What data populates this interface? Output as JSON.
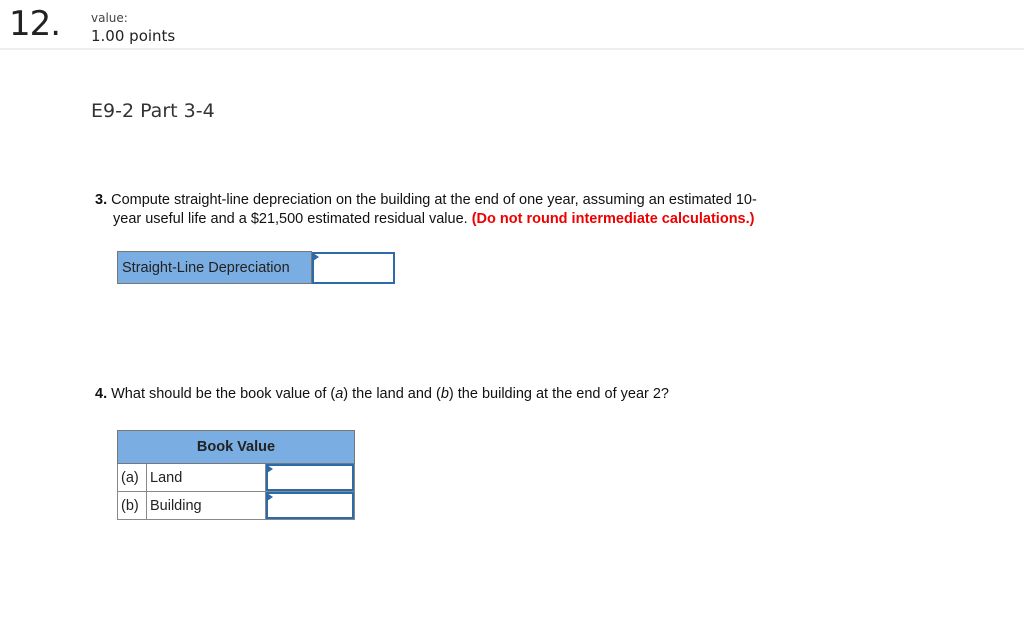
{
  "question": {
    "number": "12.",
    "value_label": "value:",
    "points": "1.00 points",
    "title": "E9-2 Part 3-4"
  },
  "part3": {
    "number": "3.",
    "text_line1": "Compute straight-line depreciation on the building at the end of one year, assuming an estimated 10-",
    "text_line2": "year useful life and a $21,500 estimated residual value.",
    "instruction": "(Do not round intermediate calculations.)",
    "table": {
      "label": "Straight-Line Depreciation",
      "value": ""
    }
  },
  "part4": {
    "number": "4.",
    "text_pre": "What should be the book value of (",
    "a": "a",
    "text_mid1": ") the land and (",
    "b": "b",
    "text_mid2": ") the building at the end of year 2?",
    "table": {
      "header": "Book Value",
      "rows": [
        {
          "key": "(a)",
          "label": "Land",
          "value": ""
        },
        {
          "key": "(b)",
          "label": "Building",
          "value": ""
        }
      ]
    }
  },
  "colors": {
    "header_fill": "#7aade2",
    "input_border": "#2f6aa8",
    "instruction_red": "#ee0000"
  }
}
